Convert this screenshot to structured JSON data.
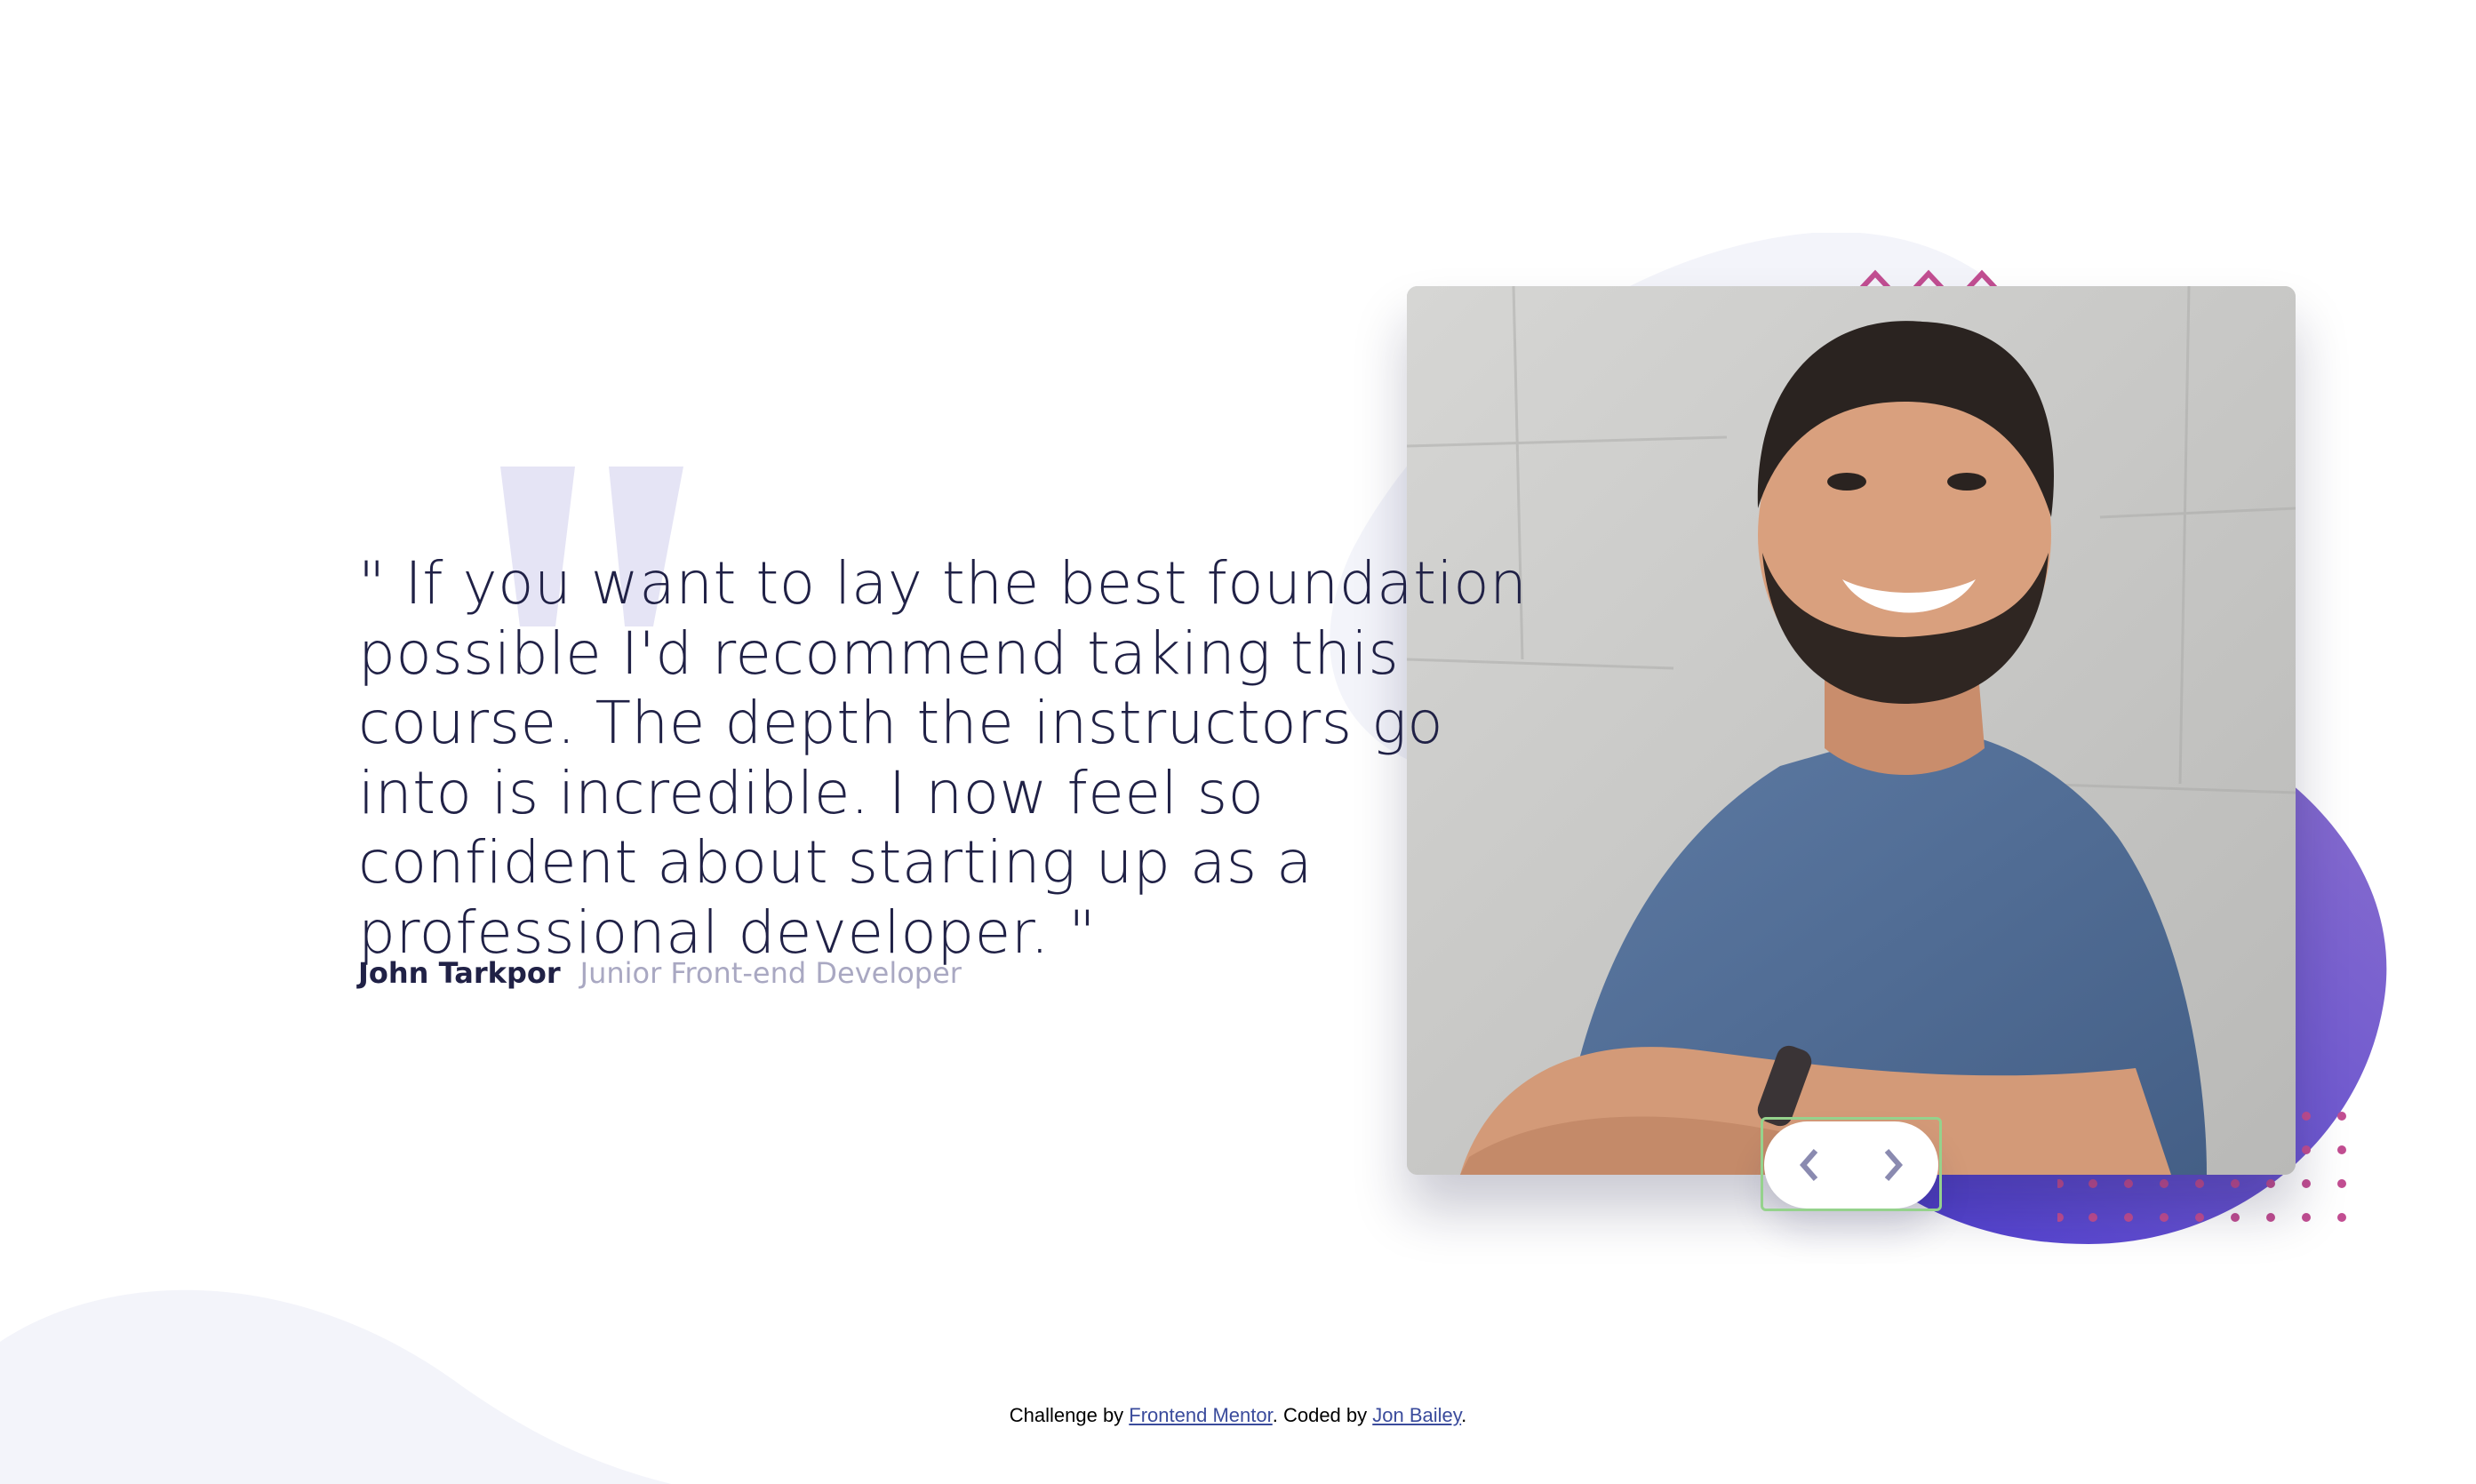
{
  "testimonial": {
    "quote": "\" If you want to lay the best foundation possible I'd recommend taking this course. The depth the instructors go into is incredible. I now feel so confident about starting up as a professional developer. \"",
    "author_name": "John Tarkpor",
    "author_role": "Junior Front-end Developer"
  },
  "photo": {
    "alt": "John Tarkpor",
    "subject": "smiling man in blue t-shirt with arms crossed"
  },
  "navigation": {
    "prev_icon": "chevron-left-icon",
    "next_icon": "chevron-right-icon"
  },
  "attribution": {
    "prefix": "Challenge by ",
    "challenge_link": "Frontend Mentor",
    "middle": ". Coded by ",
    "coder_link": "Jon Bailey",
    "suffix": "."
  },
  "colors": {
    "dark_navy": "#202146",
    "grayish_blue": "#a9a8c2",
    "light_bg": "#f3f4fa",
    "quote_mark": "#e5e4f5",
    "purple_start": "#8a6fce",
    "purple_end": "#4d3dd1",
    "accent_pink": "#c24e92",
    "focus_green": "#95d28c"
  }
}
